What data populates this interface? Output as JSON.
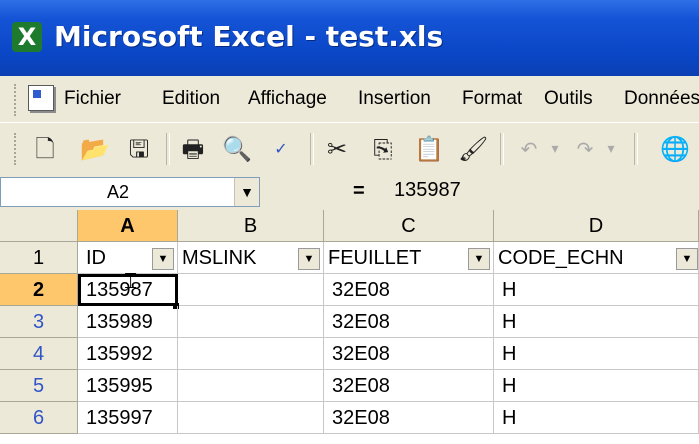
{
  "window": {
    "title": "Microsoft Excel - test.xls",
    "app_icon": "X"
  },
  "menu": {
    "items": [
      "Fichier",
      "Edition",
      "Affichage",
      "Insertion",
      "Format",
      "Outils",
      "Données"
    ]
  },
  "toolbar": {
    "icons": [
      "new-document-icon",
      "open-folder-icon",
      "save-icon",
      "print-icon",
      "print-preview-icon",
      "spell-check-icon",
      "cut-icon",
      "copy-icon",
      "paste-icon",
      "format-painter-icon",
      "undo-icon",
      "redo-icon"
    ]
  },
  "formula_bar": {
    "name_box": "A2",
    "equals": "=",
    "value": "135987"
  },
  "sheet": {
    "columns": [
      "A",
      "B",
      "C",
      "D"
    ],
    "header_row": {
      "row_number": "1",
      "cells": [
        "ID",
        "MSLINK",
        "FEUILLET",
        "CODE_ECHN"
      ]
    },
    "rows": [
      {
        "row_number": "2",
        "cells": [
          "135987",
          "",
          "32E08",
          "H"
        ]
      },
      {
        "row_number": "3",
        "cells": [
          "135989",
          "",
          "32E08",
          "H"
        ]
      },
      {
        "row_number": "4",
        "cells": [
          "135992",
          "",
          "32E08",
          "H"
        ]
      },
      {
        "row_number": "5",
        "cells": [
          "135995",
          "",
          "32E08",
          "H"
        ]
      },
      {
        "row_number": "6",
        "cells": [
          "135997",
          "",
          "32E08",
          "H"
        ]
      }
    ],
    "selected_cell": "A2",
    "colors": {
      "selected_header": "#ffc76b",
      "row_number_text": "#3155c7"
    }
  }
}
